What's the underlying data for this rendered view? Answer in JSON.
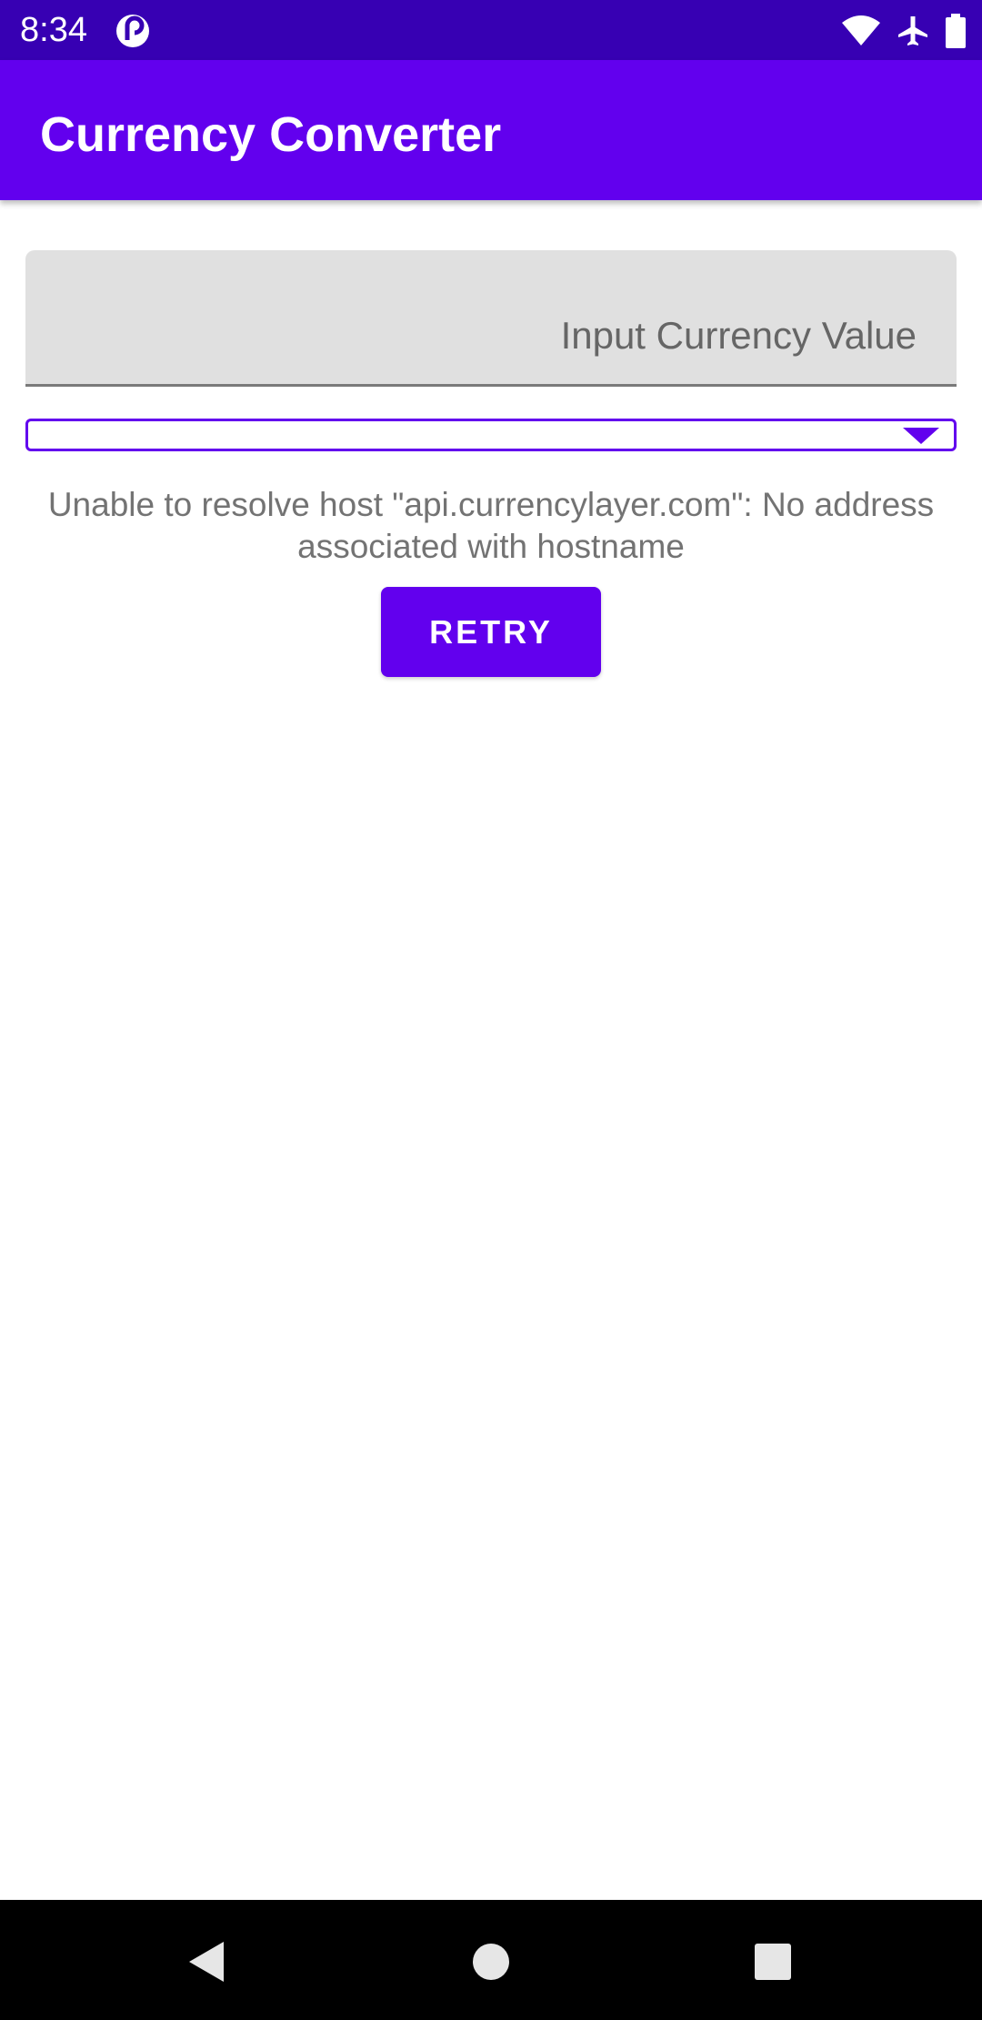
{
  "status_bar": {
    "time": "8:34",
    "app_icon": "pocket-casts-icon",
    "icons": [
      "wifi-icon",
      "airplane-mode-icon",
      "battery-icon"
    ]
  },
  "app_bar": {
    "title": "Currency Converter"
  },
  "currency_input": {
    "value": "",
    "placeholder": "Input Currency Value"
  },
  "currency_spinner": {
    "selected": "",
    "icon": "dropdown-arrow-icon"
  },
  "error": {
    "message": "Unable to resolve host \"api.currencylayer.com\": No address associated with hostname"
  },
  "retry_button": {
    "label": "RETRY"
  },
  "nav_bar": {
    "icons": [
      "back-icon",
      "home-icon",
      "recents-icon"
    ]
  },
  "colors": {
    "status_bar": "#3700b3",
    "primary": "#6200ee",
    "error_text": "#737373",
    "input_bg": "#e0e0e0"
  }
}
